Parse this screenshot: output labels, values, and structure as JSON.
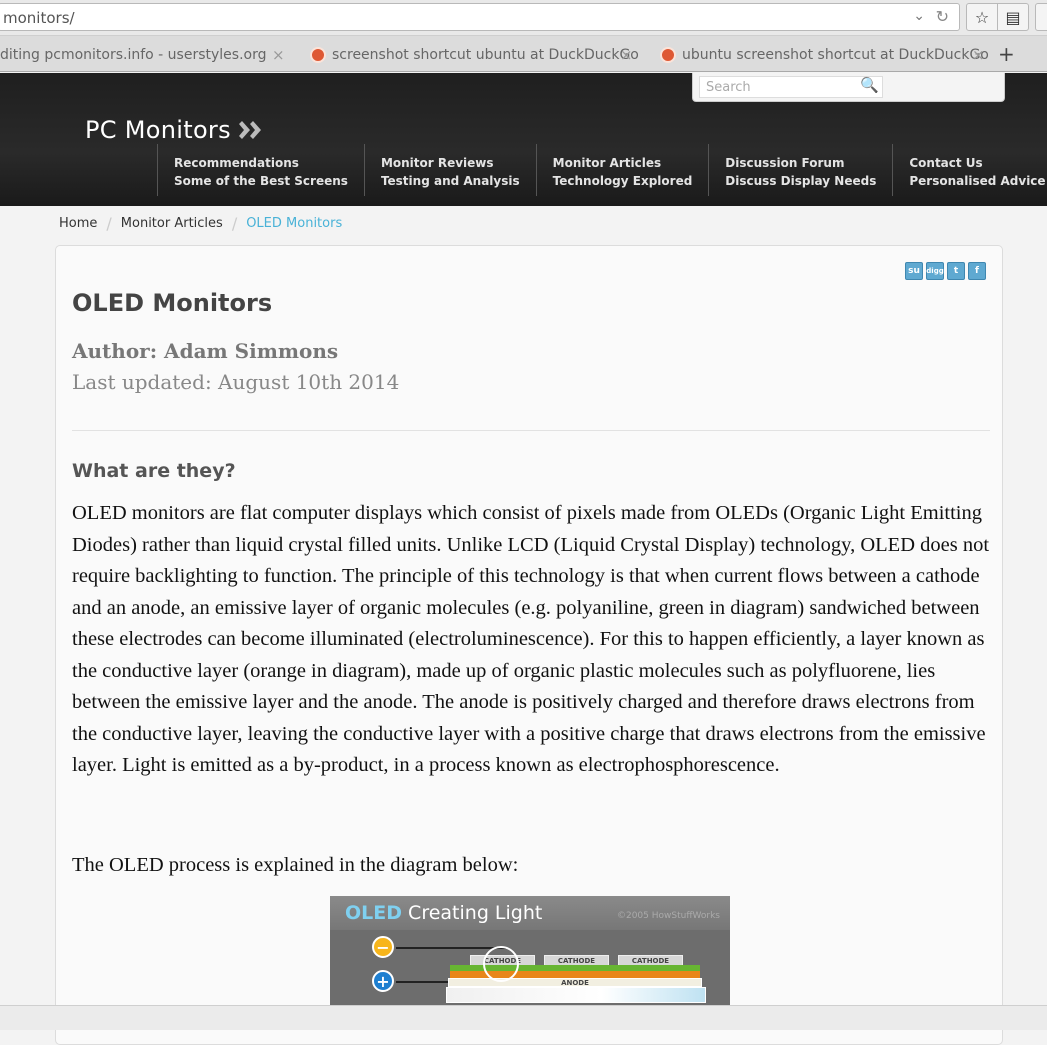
{
  "browser": {
    "url": "monitors/",
    "tabs": [
      {
        "label": "diting pcmonitors.info - userstyles.org"
      },
      {
        "label": "screenshot shortcut ubuntu at DuckDuckGo"
      },
      {
        "label": "ubuntu screenshot shortcut at DuckDuckGo"
      }
    ],
    "close_glyph": "×",
    "new_tab_glyph": "+"
  },
  "site": {
    "logo_text": "PC Monitors",
    "search_placeholder": "Search",
    "nav": [
      {
        "line1": "Recommendations",
        "line2": "Some of the Best Screens"
      },
      {
        "line1": "Monitor Reviews",
        "line2": "Testing and Analysis"
      },
      {
        "line1": "Monitor Articles",
        "line2": "Technology Explored"
      },
      {
        "line1": "Discussion Forum",
        "line2": "Discuss Display Needs"
      },
      {
        "line1": "Contact Us",
        "line2": "Personalised Advice"
      }
    ]
  },
  "breadcrumb": {
    "home": "Home",
    "section": "Monitor Articles",
    "current": "OLED Monitors",
    "separator": "/"
  },
  "article": {
    "title": "OLED Monitors",
    "author": "Author: Adam Simmons",
    "updated": "Last updated: August 10th 2014",
    "subheading": "What are they?",
    "paragraph1": "OLED monitors are flat computer displays which consist of pixels made from OLEDs (Organic Light Emitting Diodes) rather than liquid crystal filled units. Unlike LCD (Liquid Crystal Display) technology, OLED does not require backlighting to function. The principle of this technology is that when current flows between a cathode and an anode, an emissive layer of organic molecules (e.g. polyaniline, green in diagram) sandwiched between these electrodes can become illuminated (electroluminescence). For this to happen efficiently, a layer known as the conductive layer (orange in diagram), made up of organic plastic molecules such as polyfluorene, lies between the emissive layer and the anode. The anode is positively charged and therefore draws electrons from the conductive layer, leaving the conductive layer with a positive charge that draws electrons from the emissive layer. Light is emitted as a by-product, in a process known as electrophosphorescence.",
    "paragraph2": "The OLED process is explained in the diagram below:",
    "share_icons": [
      "stumbleupon-icon",
      "digg-icon",
      "twitter-icon",
      "facebook-icon"
    ],
    "share_glyphs": {
      "stumble": "su",
      "digg": "digg",
      "twitter": "t",
      "facebook": "f"
    }
  },
  "diagram": {
    "title_strong": "OLED",
    "title_rest": " Creating Light",
    "copyright": "©2005 HowStuffWorks",
    "cathode_label": "CATHODE",
    "anode_label": "ANODE",
    "minus_glyph": "−",
    "plus_glyph": "+"
  },
  "colors": {
    "header_bg": "#1f1f1f",
    "breadcrumb_active": "#49b2d7",
    "emissive_layer": "#67b532",
    "conductive_layer": "#e8861a"
  }
}
